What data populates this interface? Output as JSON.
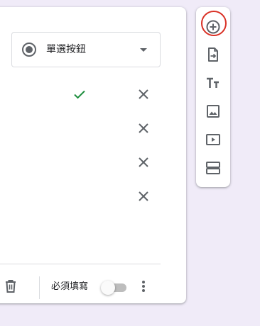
{
  "question": {
    "type_label": "單選按鈕",
    "required_label": "必須填寫",
    "required_enabled": false,
    "option_rows": 4,
    "correct_answer_marked": true
  },
  "colors": {
    "page_background": "#f0ebf8",
    "card_background": "#ffffff",
    "icon_gray": "#5f6368",
    "check_green": "#1e8e3e",
    "highlight_red": "#d93025"
  },
  "toolbar": {
    "items": [
      {
        "icon": "add-circle-icon",
        "highlighted": true
      },
      {
        "icon": "import-questions-icon"
      },
      {
        "icon": "title-text-icon"
      },
      {
        "icon": "image-icon"
      },
      {
        "icon": "video-icon"
      },
      {
        "icon": "section-icon"
      }
    ]
  }
}
